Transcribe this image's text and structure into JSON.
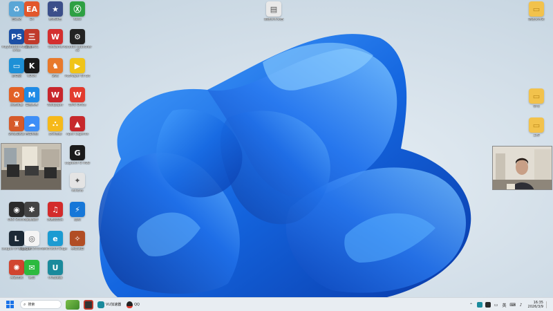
{
  "desktop": {
    "icons": [
      {
        "id": "recycle",
        "label": "回收站",
        "color": "#5aa6d6",
        "glyph": "♻"
      },
      {
        "id": "ea",
        "label": "EA",
        "color": "#e2572b",
        "glyph": "EA"
      },
      {
        "id": "pubg",
        "label": "绝地求生",
        "color": "#3b4f8a",
        "glyph": "★"
      },
      {
        "id": "xbox",
        "label": "Xbox",
        "color": "#2ea043",
        "glyph": "Ⓧ"
      },
      {
        "id": "ps",
        "label": "PlayStation Accessories",
        "color": "#1b4fa5",
        "glyph": "PS"
      },
      {
        "id": "3k",
        "label": "三国杀OL",
        "color": "#c03a2b",
        "glyph": "三"
      },
      {
        "id": "wegame",
        "label": "WeGame",
        "color": "#d42f2f",
        "glyph": "W"
      },
      {
        "id": "paradox",
        "label": "Paradox Launcher v2",
        "color": "#222222",
        "glyph": "⚙"
      },
      {
        "id": "monitor",
        "label": "此电脑",
        "color": "#1e90d6",
        "glyph": "▭"
      },
      {
        "id": "kook",
        "label": "KOOK",
        "color": "#1a1a1a",
        "glyph": "K"
      },
      {
        "id": "game3",
        "label": "游戏",
        "color": "#e8792a",
        "glyph": "♞"
      },
      {
        "id": "potplayer",
        "label": "PotPlayer 64 bit",
        "color": "#f0c419",
        "glyph": "▶"
      },
      {
        "id": "game4",
        "label": "王者荣耀",
        "color": "#e26125",
        "glyph": "✪"
      },
      {
        "id": "meitu",
        "label": "美图秀秀",
        "color": "#1e8be6",
        "glyph": "M"
      },
      {
        "id": "wallpaper",
        "label": "Wallpaper",
        "color": "#c8262c",
        "glyph": "W"
      },
      {
        "id": "wps",
        "label": "WPS Office",
        "color": "#e23b2e",
        "glyph": "W"
      },
      {
        "id": "game5",
        "label": "游戏加速器",
        "color": "#d65a2a",
        "glyph": "♜"
      },
      {
        "id": "baidu",
        "label": "百度网盘",
        "color": "#3d8ef7",
        "glyph": "☁"
      },
      {
        "id": "tiger",
        "label": "虎牙直播",
        "color": "#f6b91a",
        "glyph": "⛬"
      },
      {
        "id": "apex",
        "label": "Apex Legends",
        "color": "#c7282c",
        "glyph": "▲"
      },
      {
        "id": "logi",
        "label": "Logitech G HUB",
        "color": "#1a1a1a",
        "glyph": "G"
      },
      {
        "id": "mihoyo",
        "label": "MiHoYo",
        "color": "#e4e4e4",
        "glyph": "✦"
      },
      {
        "id": "obs",
        "label": "OBS Studio",
        "color": "#2b2b2b",
        "glyph": "◉"
      },
      {
        "id": "spider",
        "label": "蜘蛛纸牌",
        "color": "#444444",
        "glyph": "✱"
      },
      {
        "id": "netease",
        "label": "网易云音乐",
        "color": "#d32b2b",
        "glyph": "♫"
      },
      {
        "id": "battlenet",
        "label": "战网",
        "color": "#1677d8",
        "glyph": "⚡"
      },
      {
        "id": "lol",
        "label": "League of Legends",
        "color": "#1d2a36",
        "glyph": "L"
      },
      {
        "id": "chrome",
        "label": "Google Chrome",
        "color": "#f4f4f4",
        "glyph": "◎"
      },
      {
        "id": "edge",
        "label": "Microsoft Edge",
        "color": "#1b9bd2",
        "glyph": "e"
      },
      {
        "id": "steam2",
        "label": "英雄联盟",
        "color": "#b14d24",
        "glyph": "✧"
      },
      {
        "id": "game6",
        "label": "永劫无间",
        "color": "#d1442f",
        "glyph": "✺"
      },
      {
        "id": "wechat",
        "label": "微信",
        "color": "#2cba3f",
        "glyph": "✉"
      },
      {
        "id": "uu",
        "label": "UU加速器",
        "color": "#1a8a9c",
        "glyph": "U"
      },
      {
        "id": "file",
        "label": "新建文本文档",
        "color": "#e9e9e9",
        "glyph": "▤"
      },
      {
        "id": "folder1",
        "label": "新建文件夹",
        "color": "#f2c24c",
        "glyph": "▭"
      },
      {
        "id": "folder2",
        "label": "学习",
        "color": "#f2c24c",
        "glyph": "▭"
      },
      {
        "id": "folder3",
        "label": "工作",
        "color": "#f2c24c",
        "glyph": "▭"
      }
    ],
    "cam_left_label": "",
    "cam_right_label": ""
  },
  "taskbar": {
    "search_placeholder": "搜索",
    "vu_label": "VU加速器",
    "qq_label": "QQ",
    "tray_lang": "英",
    "clock_time": "16:35",
    "clock_date": "2026/3/9"
  }
}
